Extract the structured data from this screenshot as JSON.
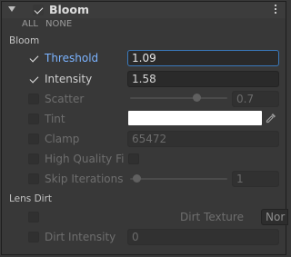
{
  "header": {
    "title": "Bloom",
    "enabled": true
  },
  "links": {
    "all": "ALL",
    "none": "NONE"
  },
  "sections": {
    "bloom": "Bloom",
    "lens_dirt": "Lens Dirt"
  },
  "properties": {
    "threshold": {
      "label": "Threshold",
      "value": "1.09",
      "override": true
    },
    "intensity": {
      "label": "Intensity",
      "value": "1.58",
      "override": true
    },
    "scatter": {
      "label": "Scatter",
      "value": "0.7",
      "override": false
    },
    "tint": {
      "label": "Tint",
      "color": "#ffffff",
      "override": false
    },
    "clamp": {
      "label": "Clamp",
      "value": "65472",
      "override": false
    },
    "high_quality_filtering": {
      "label": "High Quality Filt",
      "checked": false,
      "override": false
    },
    "skip_iterations": {
      "label": "Skip Iterations",
      "value": "1",
      "override": false
    },
    "dirt_texture": {
      "label": "Dirt Texture",
      "value": "Nor",
      "override": false
    },
    "dirt_intensity": {
      "label": "Dirt Intensity",
      "value": "0",
      "override": false
    }
  },
  "colors": {
    "accent": "#3a79bb",
    "highlight_label": "#7bb3ff",
    "panel_bg": "#383838"
  },
  "icons": {
    "foldout": "triangle-down-icon",
    "menu": "kebab-menu-icon",
    "picker": "eyedropper-icon",
    "check": "check-icon"
  }
}
